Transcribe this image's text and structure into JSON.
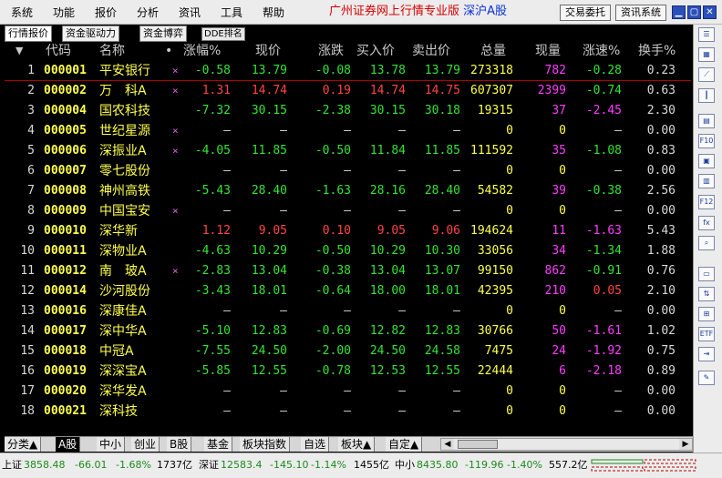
{
  "menu": [
    "系统",
    "功能",
    "报价",
    "分析",
    "资讯",
    "工具",
    "帮助"
  ],
  "brand": {
    "title": "广州证券网上行情专业版",
    "market": "深沪A股"
  },
  "buttons": {
    "trade": "交易委托",
    "info": "资讯系统"
  },
  "window_controls": [
    "minimize-icon",
    "restore-icon",
    "close-icon"
  ],
  "tabs": [
    "行情报价",
    "资金驱动力",
    "资金博弈",
    "DDE排名"
  ],
  "sort_marker": "▼",
  "columns": [
    "代码",
    "名称",
    "•",
    "涨幅%",
    "现价",
    "涨跌",
    "买入价",
    "卖出价",
    "总量",
    "现量",
    "涨速%",
    "换手%"
  ],
  "rows": [
    [
      "1",
      "000001",
      "平安银行",
      "×",
      "-0.58",
      "13.79",
      "-0.08",
      "13.78",
      "13.79",
      "273318",
      "782",
      "-0.28",
      "0.23"
    ],
    [
      "2",
      "000002",
      "万　科A",
      "×",
      "1.31",
      "14.74",
      "0.19",
      "14.74",
      "14.75",
      "607307",
      "2399",
      "-0.74",
      "0.63"
    ],
    [
      "3",
      "000004",
      "国农科技",
      "",
      "-7.32",
      "30.15",
      "-2.38",
      "30.15",
      "30.18",
      "19315",
      "37",
      "-2.45",
      "2.30"
    ],
    [
      "4",
      "000005",
      "世纪星源",
      "×",
      "—",
      "—",
      "—",
      "—",
      "—",
      "0",
      "0",
      "—",
      "0.00"
    ],
    [
      "5",
      "000006",
      "深振业A",
      "×",
      "-4.05",
      "11.85",
      "-0.50",
      "11.84",
      "11.85",
      "111592",
      "35",
      "-1.08",
      "0.83"
    ],
    [
      "6",
      "000007",
      "零七股份",
      "",
      "—",
      "—",
      "—",
      "—",
      "—",
      "0",
      "0",
      "—",
      "0.00"
    ],
    [
      "7",
      "000008",
      "神州高铁",
      "",
      "-5.43",
      "28.40",
      "-1.63",
      "28.16",
      "28.40",
      "54582",
      "39",
      "-0.38",
      "2.56"
    ],
    [
      "8",
      "000009",
      "中国宝安",
      "×",
      "—",
      "—",
      "—",
      "—",
      "—",
      "0",
      "0",
      "—",
      "0.00"
    ],
    [
      "9",
      "000010",
      "深华新",
      "",
      "1.12",
      "9.05",
      "0.10",
      "9.05",
      "9.06",
      "194624",
      "11",
      "-1.63",
      "5.43"
    ],
    [
      "10",
      "000011",
      "深物业A",
      "",
      "-4.63",
      "10.29",
      "-0.50",
      "10.29",
      "10.30",
      "33056",
      "34",
      "-1.34",
      "1.88"
    ],
    [
      "11",
      "000012",
      "南　玻A",
      "×",
      "-2.83",
      "13.04",
      "-0.38",
      "13.04",
      "13.07",
      "99150",
      "862",
      "-0.91",
      "0.76"
    ],
    [
      "12",
      "000014",
      "沙河股份",
      "",
      "-3.43",
      "18.01",
      "-0.64",
      "18.00",
      "18.01",
      "42395",
      "210",
      "0.05",
      "2.10"
    ],
    [
      "13",
      "000016",
      "深康佳A",
      "",
      "—",
      "—",
      "—",
      "—",
      "—",
      "0",
      "0",
      "—",
      "0.00"
    ],
    [
      "14",
      "000017",
      "深中华A",
      "",
      "-5.10",
      "12.83",
      "-0.69",
      "12.82",
      "12.83",
      "30766",
      "50",
      "-1.61",
      "1.02"
    ],
    [
      "15",
      "000018",
      "中冠A",
      "",
      "-7.55",
      "24.50",
      "-2.00",
      "24.50",
      "24.58",
      "7475",
      "24",
      "-1.92",
      "0.75"
    ],
    [
      "16",
      "000019",
      "深深宝A",
      "",
      "-5.85",
      "12.55",
      "-0.78",
      "12.53",
      "12.55",
      "22444",
      "6",
      "-2.18",
      "0.89"
    ],
    [
      "17",
      "000020",
      "深华发A",
      "",
      "—",
      "—",
      "—",
      "—",
      "—",
      "0",
      "0",
      "—",
      "0.00"
    ],
    [
      "18",
      "000021",
      "深科技",
      "",
      "—",
      "—",
      "—",
      "—",
      "—",
      "0",
      "0",
      "—",
      "0.00"
    ]
  ],
  "bottom_tabs": [
    "分类▲",
    "A股",
    "中小",
    "创业",
    "B股",
    "基金",
    "板块指数",
    "自选",
    "板块▲",
    "自定▲"
  ],
  "status": {
    "sh": {
      "label": "上证",
      "index": "3858.48",
      "change": "-66.01",
      "pct": "-1.68%",
      "amount": "1737亿"
    },
    "sz": {
      "label": "深证",
      "index": "12583.4",
      "change": "-145.10",
      "pct": "-1.14%",
      "amount": "1455亿"
    },
    "zx": {
      "label": "中小",
      "index": "8435.80",
      "change": "-119.96",
      "pct": "-1.40%",
      "amount": "557.2亿"
    }
  },
  "right_toolbar": [
    "list-icon",
    "grid-icon",
    "line-chart-icon",
    "candle-icon",
    "table-icon",
    "f10-icon",
    "news-icon",
    "report-icon",
    "f12-icon",
    "formula-icon",
    "search-icon",
    "folder-icon",
    "sort-icon",
    "calc-icon",
    "etf-icon",
    "export-icon",
    "note-icon"
  ],
  "colors": {
    "up": "#ff4545",
    "down": "#35e335",
    "code": "#ffff4d",
    "accent": "#ff3cff",
    "background": "#000000"
  }
}
